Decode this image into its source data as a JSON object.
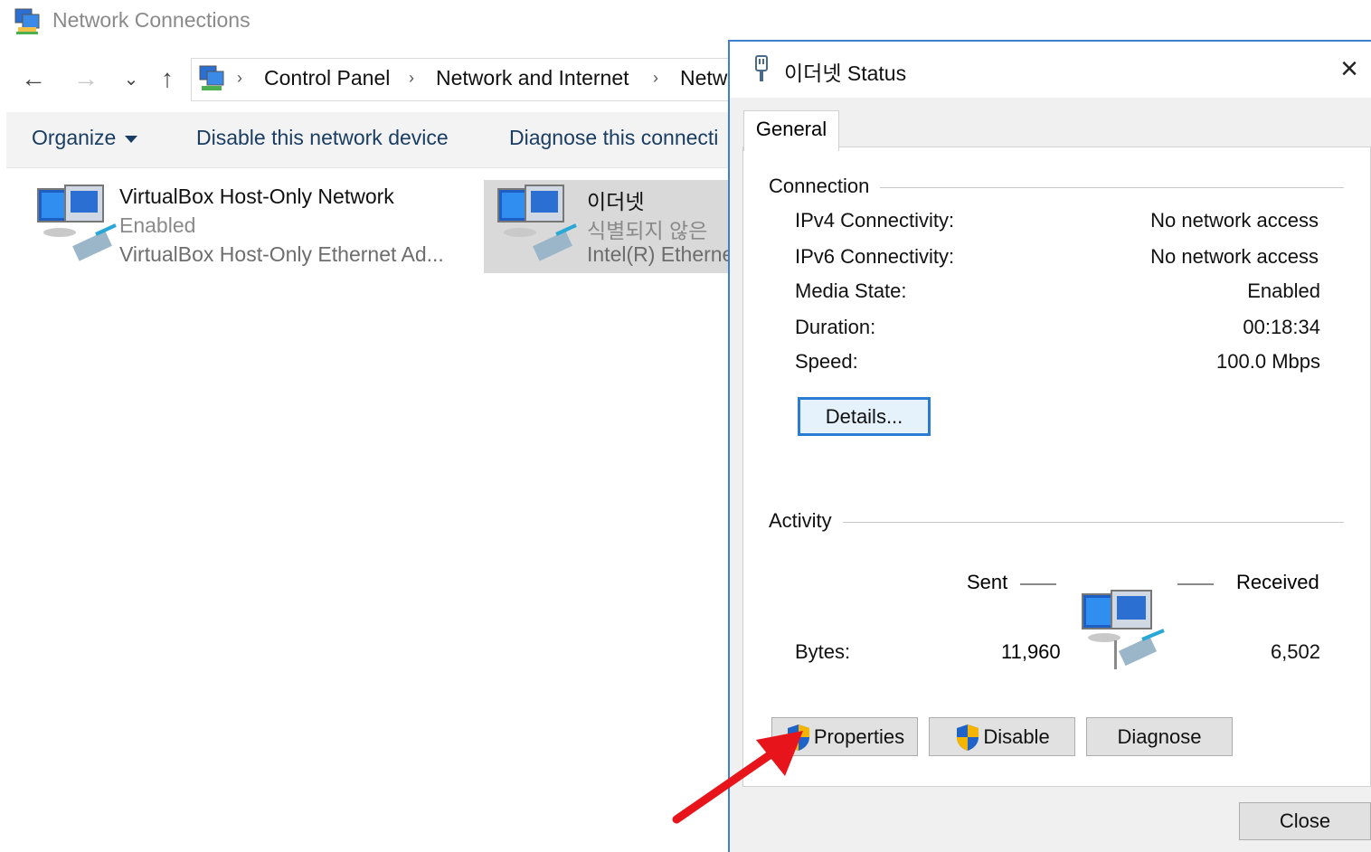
{
  "window": {
    "title": "Network Connections",
    "icon": "network-connections-icon"
  },
  "nav": {
    "back": "←",
    "forward": "→",
    "recent": "⌄",
    "up": "↑"
  },
  "breadcrumb": [
    "Control Panel",
    "Network and Internet",
    "Netw"
  ],
  "commands": {
    "organize": "Organize",
    "disable": "Disable this network device",
    "diagnose": "Diagnose this connecti"
  },
  "connections": [
    {
      "name": "VirtualBox Host-Only Network",
      "status": "Enabled",
      "device": "VirtualBox Host-Only Ethernet Ad..."
    },
    {
      "name": "이더넷",
      "status": "식별되지 않은",
      "device": "Intel(R) Etherne"
    }
  ],
  "dialog": {
    "title": "이더넷 Status",
    "close_glyph": "×",
    "tab": "General",
    "connection": {
      "label": "Connection",
      "rows": [
        {
          "label": "IPv4 Connectivity:",
          "value": "No network access"
        },
        {
          "label": "IPv6 Connectivity:",
          "value": "No network access"
        },
        {
          "label": "Media State:",
          "value": "Enabled"
        },
        {
          "label": "Duration:",
          "value": "00:18:34"
        },
        {
          "label": "Speed:",
          "value": "100.0 Mbps"
        }
      ],
      "details_button": "Details..."
    },
    "activity": {
      "label": "Activity",
      "sent": "Sent",
      "received": "Received",
      "bytes_label": "Bytes:",
      "bytes_sent": "11,960",
      "bytes_received": "6,502"
    },
    "buttons": {
      "properties": "Properties",
      "disable": "Disable",
      "diagnose": "Diagnose"
    },
    "close_button": "Close"
  },
  "colors": {
    "dialog_border": "#3f7fcf",
    "annotation_arrow": "#e8141b",
    "command_text": "#1a3d63",
    "selected_item": "#d9d9d9"
  }
}
